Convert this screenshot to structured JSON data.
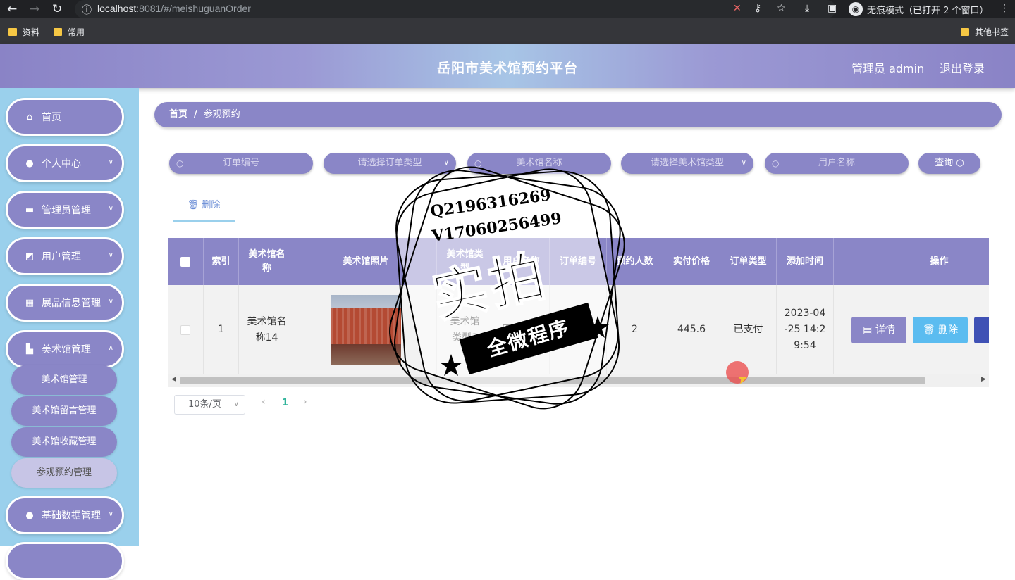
{
  "browser": {
    "url_host": "localhost",
    "url_path": ":8081/#/meishuguanOrder",
    "incognito_label": "无痕模式（已打开 2 个窗口）",
    "bookmarks": [
      "资料",
      "常用"
    ],
    "other_bookmarks": "其他书签"
  },
  "header": {
    "title": "岳阳市美术馆预约平台",
    "admin": "管理员 admin",
    "logout": "退出登录"
  },
  "sidebar": {
    "items": [
      {
        "label": "首页",
        "icon": "home-icon"
      },
      {
        "label": "个人中心",
        "icon": "user-icon"
      },
      {
        "label": "管理员管理",
        "icon": "monitor-icon"
      },
      {
        "label": "用户管理",
        "icon": "chart-icon"
      },
      {
        "label": "展品信息管理",
        "icon": "grid-icon"
      },
      {
        "label": "美术馆管理",
        "icon": "building-icon"
      }
    ],
    "sub_items": [
      "美术馆管理",
      "美术馆留言管理",
      "美术馆收藏管理",
      "参观预约管理"
    ],
    "last_item": {
      "label": "基础数据管理",
      "icon": "user-icon"
    }
  },
  "breadcrumb": {
    "home": "首页",
    "sep": "/",
    "current": "参观预约"
  },
  "filters": {
    "order_no": "订单编号",
    "order_type": "请选择订单类型",
    "gallery_name": "美术馆名称",
    "gallery_type": "请选择美术馆类型",
    "user_name": "用户名称",
    "query": "查询"
  },
  "actions": {
    "delete": "删除"
  },
  "table": {
    "columns": [
      "索引",
      "美术馆名称",
      "美术馆照片",
      "美术馆类型",
      "用户名称",
      "订单编号",
      "预约人数",
      "实付价格",
      "订单类型",
      "添加时间",
      "操作"
    ],
    "rows": [
      {
        "index": "1",
        "gallery_name": "美术馆名称14",
        "gallery_type": "美术馆类型3",
        "user_name": "用户名称",
        "order_no": "1…408",
        "people": "2",
        "price": "445.6",
        "order_type": "已支付",
        "time": "2023-04-25 14:29:54"
      }
    ],
    "btn_detail": "详情",
    "btn_delete": "删除"
  },
  "pagination": {
    "page_size": "10条/页",
    "current": "1"
  },
  "watermark": {
    "line1": "Q2196316269",
    "line2": "V17060256499",
    "big": "实拍",
    "band": "全微程序"
  },
  "colors": {
    "primary": "#8a86c7",
    "sidebar_bg": "#9ad0ec",
    "detail_btn": "#8a86c7",
    "delete_btn": "#5bbcf0"
  }
}
